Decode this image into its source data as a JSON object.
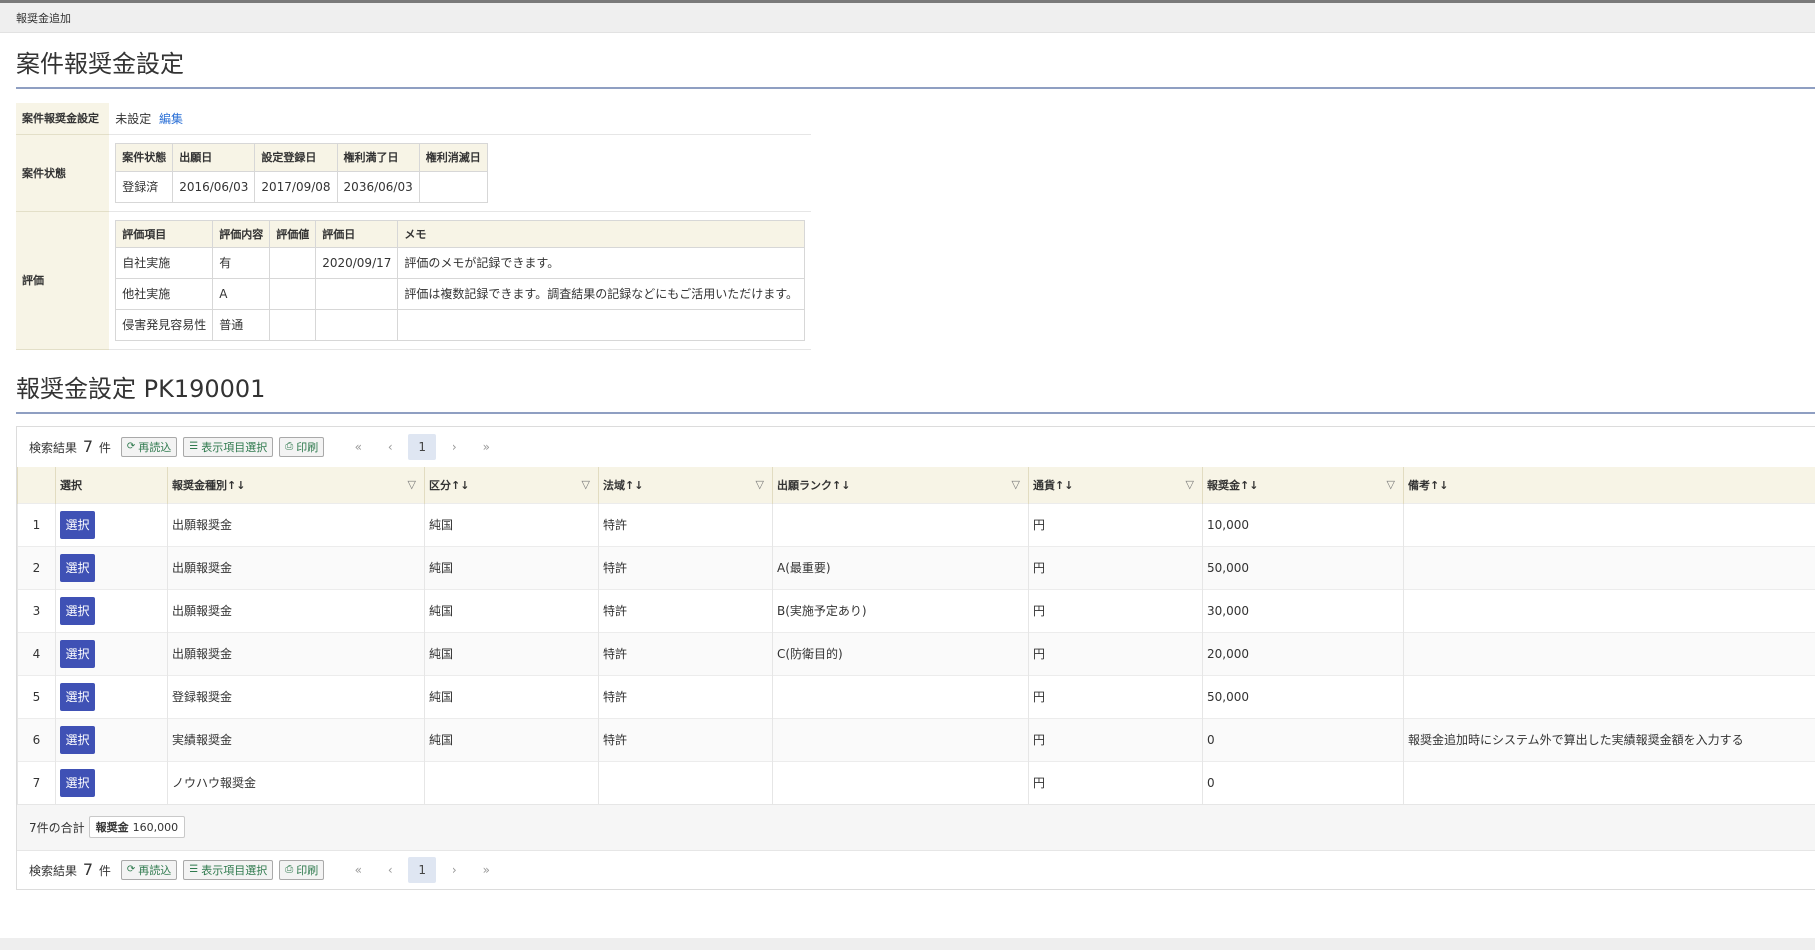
{
  "tab": {
    "label": "報奨金追加"
  },
  "case_section": {
    "title": "案件報奨金設定",
    "setting_label": "案件報奨金設定",
    "setting_value": "未設定",
    "edit_link": "編集",
    "status_label": "案件状態",
    "status_headers": [
      "案件状態",
      "出願日",
      "設定登録日",
      "権利満了日",
      "権利消滅日"
    ],
    "status_values": [
      "登録済",
      "2016/06/03",
      "2017/09/08",
      "2036/06/03",
      ""
    ],
    "eval_label": "評価",
    "eval_headers": [
      "評価項目",
      "評価内容",
      "評価値",
      "評価日",
      "メモ"
    ],
    "eval_rows": [
      [
        "自社実施",
        "有",
        "",
        "2020/09/17",
        "評価のメモが記録できます。"
      ],
      [
        "他社実施",
        "A",
        "",
        "",
        "評価は複数記録できます。調査結果の記録などにもご活用いただけます。"
      ],
      [
        "侵害発見容易性",
        "普通",
        "",
        "",
        ""
      ]
    ]
  },
  "reward_section": {
    "title": "報奨金設定 PK190001",
    "result_prefix": "検索結果",
    "result_count": "7",
    "result_suffix": "件",
    "reload_label": "再読込",
    "columns_label": "表示項目選択",
    "print_label": "印刷",
    "pager": {
      "first": "«",
      "prev": "‹",
      "page": "1",
      "next": "›",
      "last": "»"
    },
    "headers": {
      "select": "選択",
      "type": "報奨金種別↑↓",
      "division": "区分↑↓",
      "law": "法域↑↓",
      "rank": "出願ランク↑↓",
      "currency": "通貨↑↓",
      "amount": "報奨金↑↓",
      "note": "備考↑↓"
    },
    "select_button": "選択",
    "rows": [
      {
        "no": "1",
        "type": "出願報奨金",
        "division": "純国",
        "law": "特許",
        "rank": "",
        "currency": "円",
        "amount": "10,000",
        "note": ""
      },
      {
        "no": "2",
        "type": "出願報奨金",
        "division": "純国",
        "law": "特許",
        "rank": "A(最重要)",
        "currency": "円",
        "amount": "50,000",
        "note": ""
      },
      {
        "no": "3",
        "type": "出願報奨金",
        "division": "純国",
        "law": "特許",
        "rank": "B(実施予定あり)",
        "currency": "円",
        "amount": "30,000",
        "note": ""
      },
      {
        "no": "4",
        "type": "出願報奨金",
        "division": "純国",
        "law": "特許",
        "rank": "C(防衛目的)",
        "currency": "円",
        "amount": "20,000",
        "note": ""
      },
      {
        "no": "5",
        "type": "登録報奨金",
        "division": "純国",
        "law": "特許",
        "rank": "",
        "currency": "円",
        "amount": "50,000",
        "note": ""
      },
      {
        "no": "6",
        "type": "実績報奨金",
        "division": "純国",
        "law": "特許",
        "rank": "",
        "currency": "円",
        "amount": "0",
        "note": "報奨金追加時にシステム外で算出した実績報奨金額を入力する"
      },
      {
        "no": "7",
        "type": "ノウハウ報奨金",
        "division": "",
        "law": "",
        "rank": "",
        "currency": "円",
        "amount": "0",
        "note": ""
      }
    ],
    "totals_label": "7件の合計",
    "totals_badge_label": "報奨金",
    "totals_badge_value": "160,000"
  }
}
